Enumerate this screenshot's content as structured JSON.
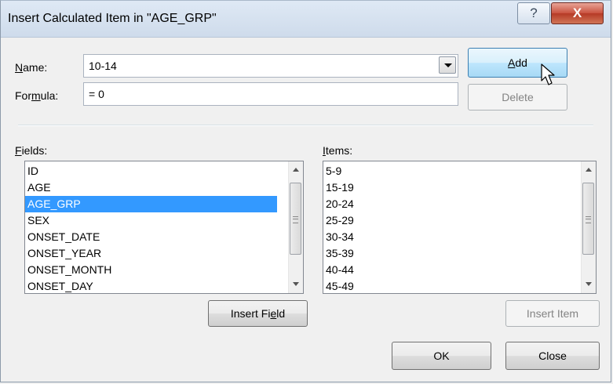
{
  "window": {
    "title": "Insert Calculated Item in \"AGE_GRP\"",
    "help_glyph": "?",
    "close_glyph": "X"
  },
  "name": {
    "label_ul": "N",
    "label_rest": "ame:",
    "value": "10-14"
  },
  "formula": {
    "label_pre": "For",
    "label_ul": "m",
    "label_rest": "ula:",
    "value": "= 0"
  },
  "buttons": {
    "add_ul": "A",
    "add_rest": "dd",
    "delete": "Delete",
    "insert_field_pre": "Insert Fi",
    "insert_field_ul": "e",
    "insert_field_rest": "ld",
    "insert_item": "Insert Item",
    "ok": "OK",
    "close": "Close"
  },
  "fields": {
    "label_ul": "F",
    "label_rest": "ields:",
    "items": [
      "ID",
      "AGE",
      "AGE_GRP",
      "SEX",
      "ONSET_DATE",
      "ONSET_YEAR",
      "ONSET_MONTH",
      "ONSET_DAY"
    ],
    "selected": "AGE_GRP"
  },
  "items": {
    "label_ul": "I",
    "label_rest": "tems:",
    "items": [
      "5-9",
      "15-19",
      "20-24",
      "25-29",
      "30-34",
      "35-39",
      "40-44",
      "45-49"
    ]
  },
  "colors": {
    "selection": "#3399ff",
    "close_red": "#c9523f",
    "hot_button": "#bee6fd"
  },
  "icons": {
    "cursor": "arrow-pointer-icon"
  }
}
